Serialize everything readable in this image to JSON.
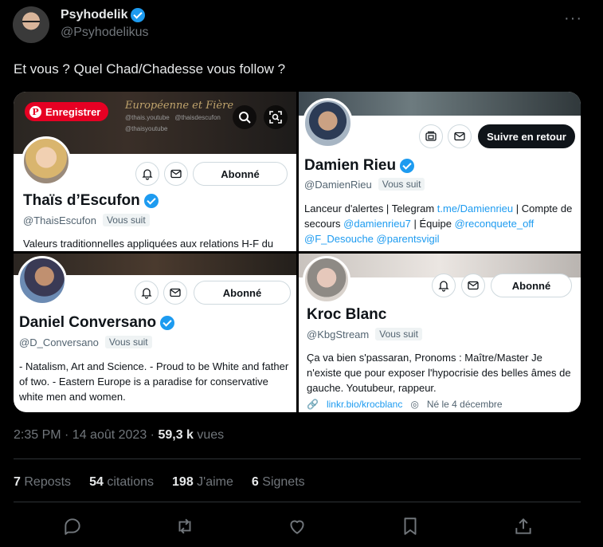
{
  "tweet": {
    "author_name": "Psyhodelik",
    "author_handle": "@Psyhodelikus",
    "more_label": "···",
    "text": "Et vous ? Quel Chad/Chadesse vous follow ?",
    "timestamp": "2:35 PM · 14 août 2023 · ",
    "views_count": "59,3 k",
    "views_label": " vues"
  },
  "media": {
    "save_label": "Enregistrer",
    "profiles": [
      {
        "name": "Thaïs d’Escufon",
        "handle": "@ThaisEscufon",
        "follows_you": "Vous suit",
        "button": "Abonné",
        "bio": "Valeurs traditionnelles appliquées aux relations H-F du",
        "banner_title": "Européenne et Fière",
        "banner_socials": [
          "@thais.youtube",
          "@thaisyoutube",
          "@thaisdescufon"
        ]
      },
      {
        "name": "Damien Rieu",
        "handle": "@DamienRieu",
        "follows_you": "Vous suit",
        "button": "Suivre en retour",
        "bio_part1": "Lanceur d'alertes | Telegram ",
        "bio_link1": "t.me/Damienrieu",
        "bio_part2": " | Compte de secours ",
        "bio_link2": "@damienrieu7",
        "bio_part3": " | Équipe ",
        "bio_link3": "@reconquete_off",
        "bio_link4": "@F_Desouche",
        "bio_link5": "@parentsvigil"
      },
      {
        "name": "Daniel Conversano",
        "handle": "@D_Conversano",
        "follows_you": "Vous suit",
        "button": "Abonné",
        "bio": "- Natalism, Art and Science. - Proud to be White and father of two. - Eastern Europe is a paradise for conservative white men and women."
      },
      {
        "name": "Kroc Blanc",
        "handle": "@KbgStream",
        "follows_you": "Vous suit",
        "button": "Abonné",
        "bio": "Ça va bien s'passaran, Pronoms : Maître/Master Je n'existe que pour exposer l'hypocrisie des belles âmes de gauche. Youtubeur, rappeur.",
        "link": "linkr.bio/krocblanc",
        "born": "Né le 4 décembre"
      }
    ]
  },
  "stats": [
    {
      "count": "7",
      "label": "Reposts"
    },
    {
      "count": "54",
      "label": "citations"
    },
    {
      "count": "198",
      "label": "J'aime"
    },
    {
      "count": "6",
      "label": "Signets"
    }
  ],
  "colors": {
    "background": "#000000",
    "accent": "#1d9bf0",
    "pinterest": "#e60023",
    "muted": "#71767b"
  },
  "icons": [
    "reply-icon",
    "repost-icon",
    "like-icon",
    "bookmark-icon",
    "share-icon"
  ]
}
